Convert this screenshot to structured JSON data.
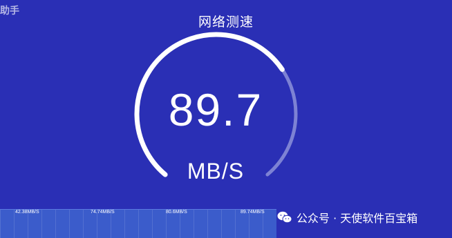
{
  "header": {
    "corner_label": "助手",
    "title": "网络测速"
  },
  "gauge": {
    "value": "89.7",
    "unit": "MB/S",
    "progress": 0.7,
    "colors": {
      "active": "#ffffff",
      "track": "#7d82d4"
    }
  },
  "history": {
    "items": [
      "42.38MB/S",
      "74.74MB/S",
      "80.6MB/S",
      "89.74MB/S"
    ]
  },
  "watermark": {
    "icon": "wechat-icon",
    "text": "公众号 · 天使软件百宝箱"
  },
  "colors": {
    "background": "#2a2fb5",
    "strip": "#3b5ccb"
  }
}
